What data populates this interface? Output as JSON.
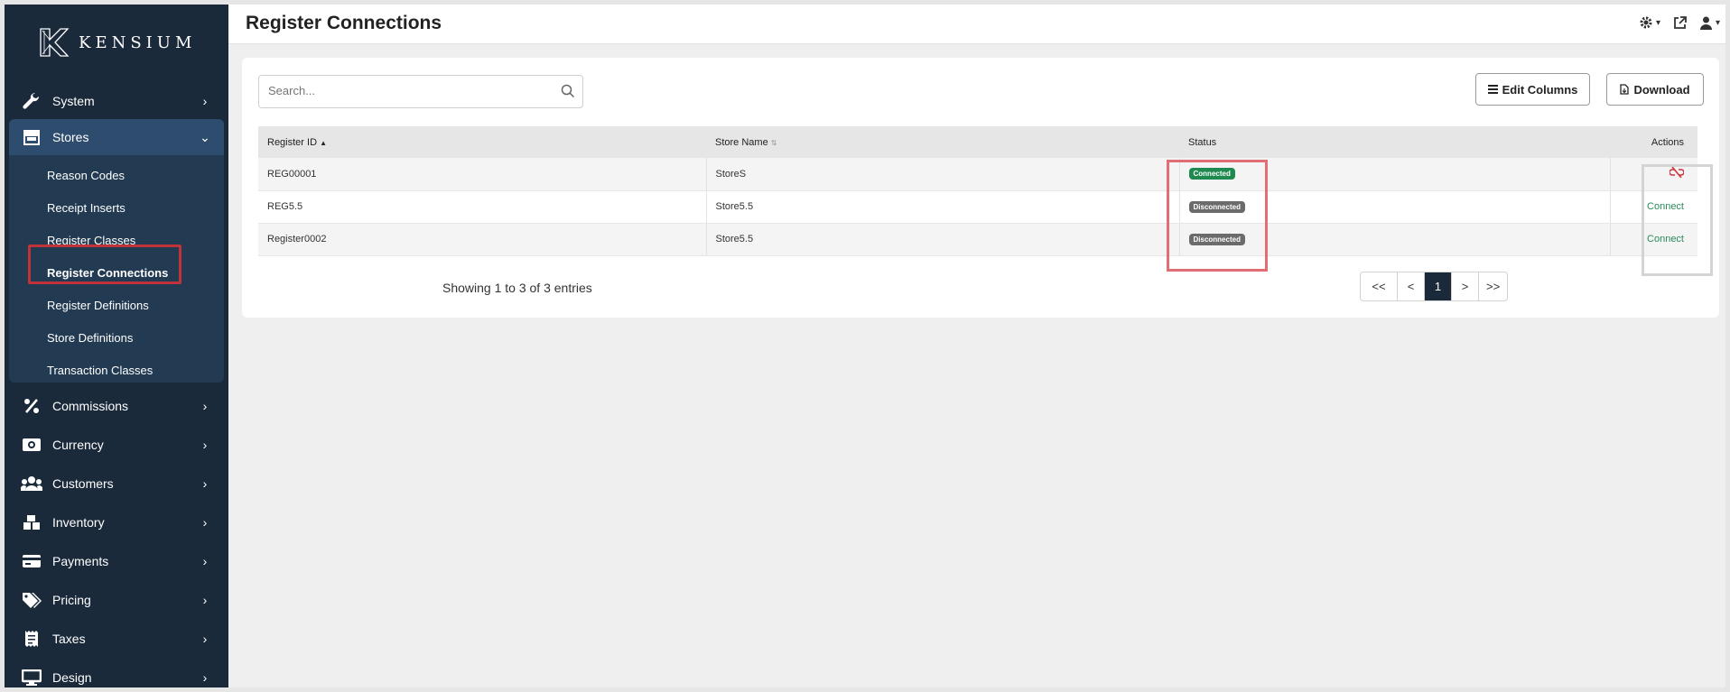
{
  "brand": {
    "name": "KENSIUM"
  },
  "header": {
    "title": "Register Connections"
  },
  "sidebar": {
    "items": [
      {
        "label": "System",
        "icon": "wrench-icon"
      },
      {
        "label": "Stores",
        "icon": "store-icon",
        "expanded": true
      },
      {
        "label": "Commissions",
        "icon": "percent-icon"
      },
      {
        "label": "Currency",
        "icon": "money-icon"
      },
      {
        "label": "Customers",
        "icon": "users-icon"
      },
      {
        "label": "Inventory",
        "icon": "boxes-icon"
      },
      {
        "label": "Payments",
        "icon": "credit-card-icon"
      },
      {
        "label": "Pricing",
        "icon": "tags-icon"
      },
      {
        "label": "Taxes",
        "icon": "receipt-icon"
      },
      {
        "label": "Design",
        "icon": "monitor-icon"
      }
    ],
    "stores_submenu": [
      "Reason Codes",
      "Receipt Inserts",
      "Register Classes",
      "Register Connections",
      "Register Definitions",
      "Store Definitions",
      "Transaction Classes"
    ],
    "active_submenu": "Register Connections"
  },
  "toolbar": {
    "search_placeholder": "Search...",
    "edit_columns_label": "Edit Columns",
    "download_label": "Download"
  },
  "table": {
    "columns": [
      "Register ID",
      "Store Name",
      "Status",
      "Actions"
    ],
    "rows": [
      {
        "register_id": "REG00001",
        "store_name": "StoreS",
        "status": "Connected",
        "action": "disconnect-icon"
      },
      {
        "register_id": "REG5.5",
        "store_name": "Store5.5",
        "status": "Disconnected",
        "action": "Connect"
      },
      {
        "register_id": "Register0002",
        "store_name": "Store5.5",
        "status": "Disconnected",
        "action": "Connect"
      }
    ]
  },
  "footer": {
    "showing": "Showing 1 to 3 of 3 entries",
    "pager": [
      "<<",
      "<",
      "1",
      ">",
      ">>"
    ],
    "current_page": "1"
  },
  "colors": {
    "sidebar_bg": "#1b2a3b",
    "active_bg": "#2e4d6e",
    "connected": "#1e8a4f",
    "disconnected": "#6b6b6b",
    "link": "#2b8a5a",
    "highlight_red": "#c0333b"
  }
}
